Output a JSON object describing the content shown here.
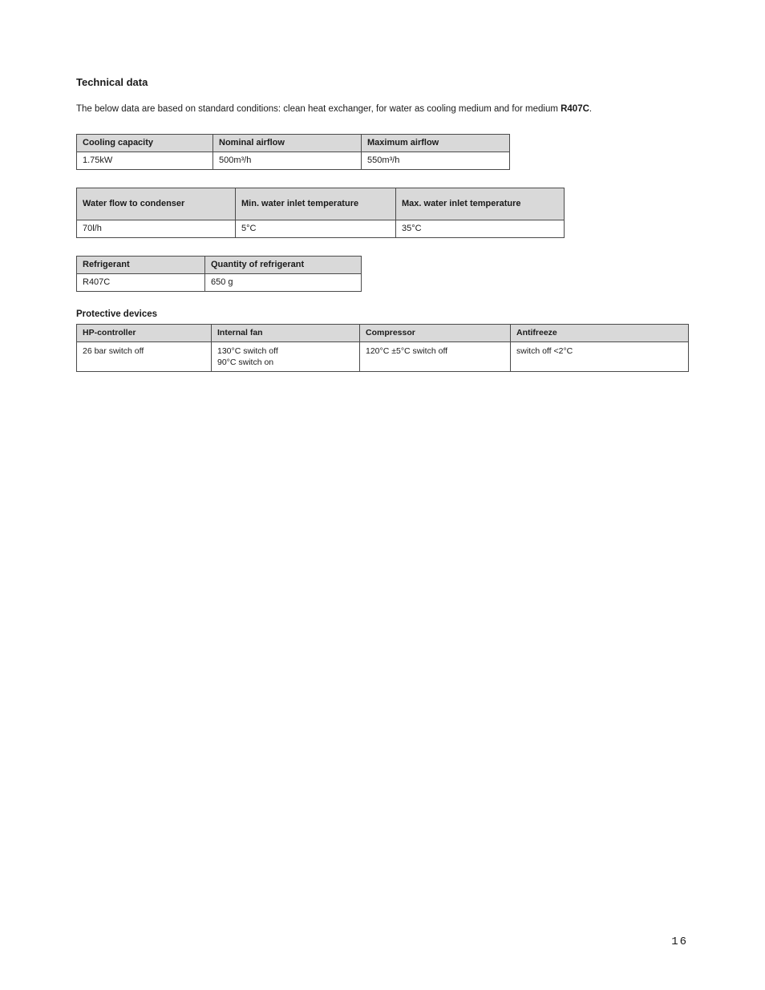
{
  "heading": "Technical data",
  "intro_prefix": "The below data are based on standard conditions: clean heat exchanger, for water as cooling medium and for medium ",
  "intro_bold": "R407C",
  "intro_suffix": ".",
  "table1": {
    "headers": [
      "Cooling capacity",
      "Nominal airflow",
      "Maximum airflow"
    ],
    "row": [
      "1.75kW",
      "500m³/h",
      "550m³/h"
    ]
  },
  "table2": {
    "headers": [
      "Water flow to condenser",
      "Min. water inlet temperature",
      "Max. water inlet temperature"
    ],
    "row": [
      "70l/h",
      "5°C",
      "35°C"
    ]
  },
  "table3": {
    "headers": [
      "Refrigerant",
      "Quantity of refrigerant"
    ],
    "row": [
      "R407C",
      "650 g"
    ]
  },
  "caption": "Protective devices",
  "table4": {
    "headers": [
      "HP-controller",
      "Internal fan",
      "Compressor",
      "Antifreeze"
    ],
    "row": [
      "26 bar switch off",
      "130°C switch off\n90°C switch on",
      "120°C ±5°C switch off",
      "switch off <2°C"
    ]
  },
  "pageNumber": "16"
}
